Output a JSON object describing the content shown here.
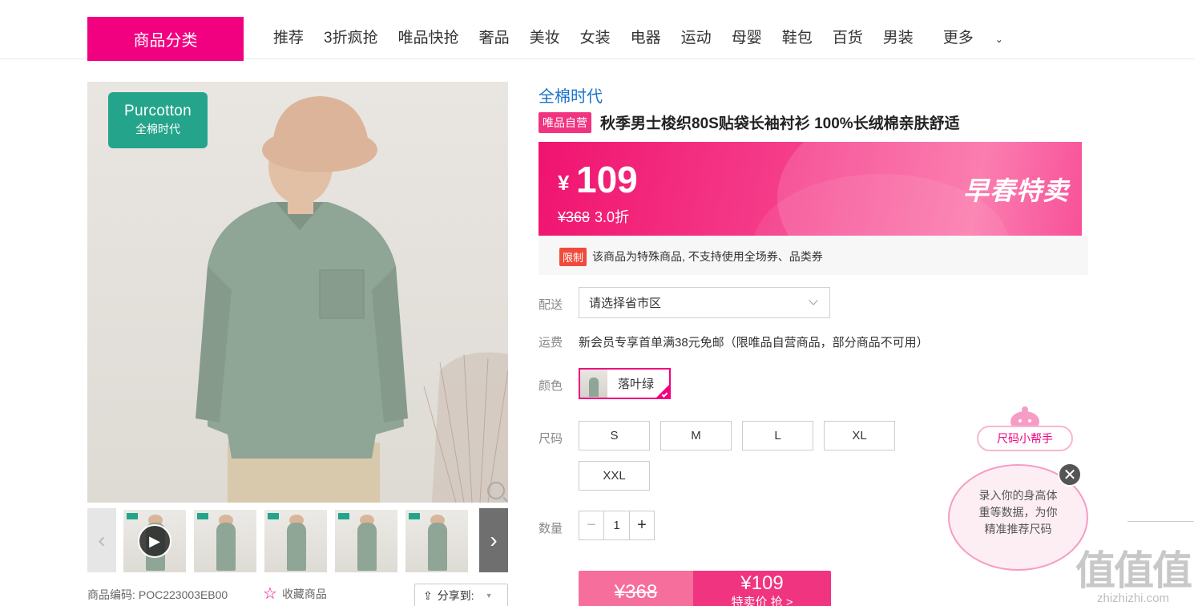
{
  "nav": {
    "category_button": "商品分类",
    "items": [
      "推荐",
      "3折疯抢",
      "唯品快抢",
      "奢品",
      "美妆",
      "女装",
      "电器",
      "运动",
      "母婴",
      "鞋包",
      "百货",
      "男装"
    ],
    "more": "更多"
  },
  "gallery": {
    "logo_line1": "Purcotton",
    "logo_line2": "全棉时代",
    "product_code_label": "商品编码:",
    "product_code": "POC223003EB00",
    "favorite": "收藏商品",
    "share": "分享到:"
  },
  "product": {
    "brand": "全棉时代",
    "self_tag": "唯品自营",
    "title": "秋季男士梭织80S贴袋长袖衬衫 100%长绒棉亲肤舒适",
    "currency": "¥",
    "price": "109",
    "original_price": "¥368",
    "discount": "3.0折",
    "promo_label": "早春特卖",
    "limit_tag": "限制",
    "limit_text": "该商品为特殊商品, 不支持使用全场券、品类券"
  },
  "options": {
    "ship_label": "配送",
    "ship_placeholder": "请选择省市区",
    "freight_label": "运费",
    "freight_text": "新会员专享首单满38元免邮（限唯品自营商品，部分商品不可用）",
    "color_label": "颜色",
    "color_value": "落叶绿",
    "size_label": "尺码",
    "sizes": [
      "S",
      "M",
      "L",
      "XL",
      "XXL"
    ],
    "qty_label": "数量",
    "qty_value": "1",
    "qty_minus": "−",
    "qty_plus": "+"
  },
  "buy": {
    "orig": "¥368",
    "price": "¥109",
    "sub": "特卖价 抢 >"
  },
  "helper": {
    "pill": "尺码小帮手",
    "line1": "录入你的身高体",
    "line2": "重等数据，为你",
    "line3": "精准推荐尺码",
    "close": "✕"
  },
  "watermark": {
    "big": "值值值",
    "small": "zhizhizhi.com"
  },
  "colors": {
    "brand_pink": "#f10180",
    "link_blue": "#1a73c9",
    "logo_green": "#24a58b"
  }
}
